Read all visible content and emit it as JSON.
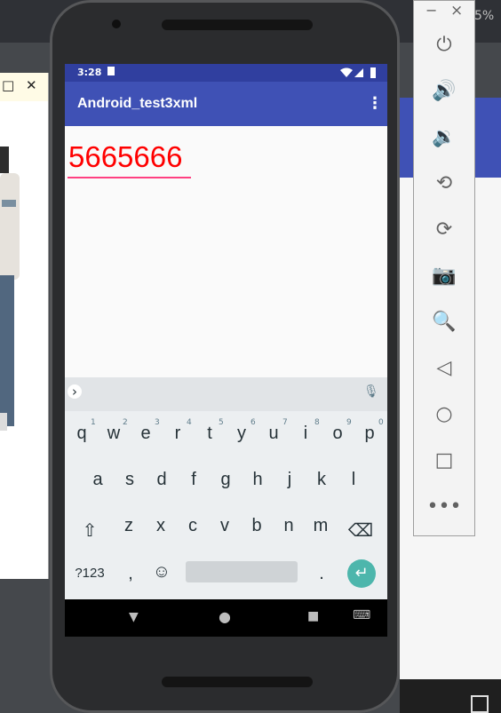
{
  "desktop": {
    "battery_text": "5%"
  },
  "image_window": {
    "maximize_icon": "□",
    "close_icon": "✕"
  },
  "phone": {
    "status": {
      "time": "3:28"
    },
    "app": {
      "title": "Android_test3xml",
      "overflow_icon": "⋮"
    },
    "edit_text": {
      "value": "5665666",
      "color": "#ff0000"
    },
    "keyboard": {
      "row1": [
        {
          "k": "q",
          "n": "1"
        },
        {
          "k": "w",
          "n": "2"
        },
        {
          "k": "e",
          "n": "3"
        },
        {
          "k": "r",
          "n": "4"
        },
        {
          "k": "t",
          "n": "5"
        },
        {
          "k": "y",
          "n": "6"
        },
        {
          "k": "u",
          "n": "7"
        },
        {
          "k": "i",
          "n": "8"
        },
        {
          "k": "o",
          "n": "9"
        },
        {
          "k": "p",
          "n": "0"
        }
      ],
      "row2": [
        "a",
        "s",
        "d",
        "f",
        "g",
        "h",
        "j",
        "k",
        "l"
      ],
      "row3": [
        "z",
        "x",
        "c",
        "v",
        "b",
        "n",
        "m"
      ],
      "symbols_label": "?123",
      "comma": ",",
      "period": ".",
      "emoji_icon": "☺",
      "shift_icon": "⇧",
      "backspace_icon": "⌫",
      "enter_icon": "↵",
      "expand_icon": "›",
      "mic_icon": "🎙"
    },
    "nav": {
      "back_icon": "▼",
      "home_icon": "●",
      "recents_icon": "■",
      "keyboard_icon": "⌨"
    }
  },
  "emulator_toolbar": {
    "minimize_icon": "−",
    "close_icon": "×",
    "tools": [
      {
        "name": "power-icon",
        "glyph": "⏻"
      },
      {
        "name": "volume-up-icon",
        "glyph": "🔊"
      },
      {
        "name": "volume-down-icon",
        "glyph": "🔉"
      },
      {
        "name": "rotate-left-icon",
        "glyph": "⟲"
      },
      {
        "name": "rotate-right-icon",
        "glyph": "⟳"
      },
      {
        "name": "camera-icon",
        "glyph": "📷"
      },
      {
        "name": "zoom-icon",
        "glyph": "🔍"
      },
      {
        "name": "back-icon",
        "glyph": "◁"
      },
      {
        "name": "home-icon",
        "glyph": "○"
      },
      {
        "name": "overview-icon",
        "glyph": "□"
      },
      {
        "name": "more-icon",
        "glyph": "•••"
      }
    ]
  }
}
